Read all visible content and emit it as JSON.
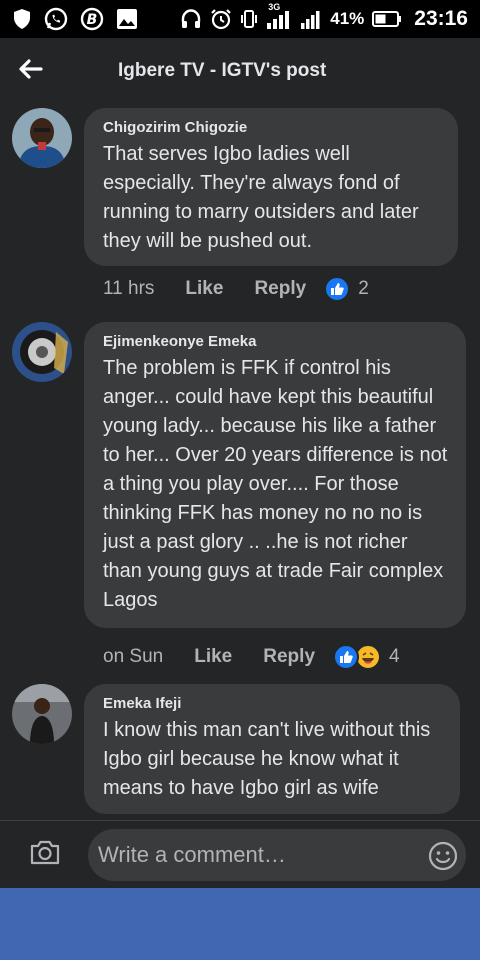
{
  "status_bar": {
    "network_type": "3G",
    "battery": "41%",
    "time": "23:16"
  },
  "header": {
    "title": "Igbere TV - IGTV's post"
  },
  "comments": [
    {
      "author": "Chigozirim Chigozie",
      "text": "That serves Igbo ladies well especially. They're always fond of running to marry outsiders and later they will be pushed out.",
      "time": "11 hrs",
      "like_label": "Like",
      "reply_label": "Reply",
      "reaction_count": "2",
      "reactions": [
        "like"
      ]
    },
    {
      "author": "Ejimenkeonye Emeka",
      "text": "The problem is FFK if control his anger... could have kept this beautiful young lady... because his like a father to her... Over 20 years difference is not a thing you play over.... For those thinking FFK has money no no no is just a past glory .. ..he is not richer than young guys at trade Fair complex Lagos",
      "time": "on Sun",
      "like_label": "Like",
      "reply_label": "Reply",
      "reaction_count": "4",
      "reactions": [
        "like",
        "haha"
      ]
    },
    {
      "author": "Emeka Ifeji",
      "text": "I know this man can't live without this Igbo girl because he know what it means to have Igbo girl as wife",
      "time": "",
      "like_label": "",
      "reply_label": "",
      "reaction_count": "",
      "reactions": []
    }
  ],
  "composer": {
    "placeholder": "Write a comment…"
  },
  "colors": {
    "background": "#242526",
    "bubble": "#3a3b3c",
    "like_blue": "#1877f2",
    "haha_yellow": "#f7b928",
    "bottom_band": "#4267b2"
  }
}
